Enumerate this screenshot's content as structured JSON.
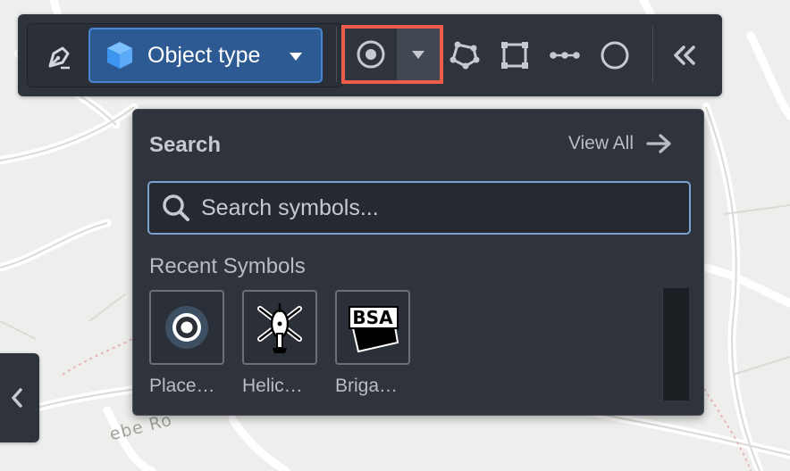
{
  "map": {
    "road_label": "ebe Ro"
  },
  "toolbar": {
    "object_type_label": "Object type",
    "tools": [
      {
        "name": "point-tool",
        "icon": "target-circle-icon"
      },
      {
        "name": "point-dropdown",
        "icon": "caret-down-icon"
      },
      {
        "name": "polygon-tool",
        "icon": "polygon-icon"
      },
      {
        "name": "rectangle-tool",
        "icon": "dashed-square-icon"
      },
      {
        "name": "line-tool",
        "icon": "polyline-icon"
      },
      {
        "name": "circle-tool",
        "icon": "circle-icon"
      },
      {
        "name": "collapse-toolbar",
        "icon": "double-chevron-left-icon"
      }
    ]
  },
  "popover": {
    "title": "Search",
    "view_all_label": "View All",
    "search_placeholder": "Search symbols...",
    "search_value": "",
    "recent_title": "Recent Symbols",
    "symbols": [
      {
        "label": "Place…",
        "icon": "placemark-target-icon"
      },
      {
        "label": "Helic…",
        "icon": "helicopter-icon"
      },
      {
        "label": "Briga…",
        "icon": "bsa-badge-icon"
      }
    ],
    "bsa_text": "BSA"
  },
  "colors": {
    "toolbar_bg": "#2f343c",
    "accent_blue": "#2d5a92",
    "accent_border": "#4a86cf",
    "highlight_red": "#ee5c4a",
    "text_light": "#c6cad0"
  }
}
